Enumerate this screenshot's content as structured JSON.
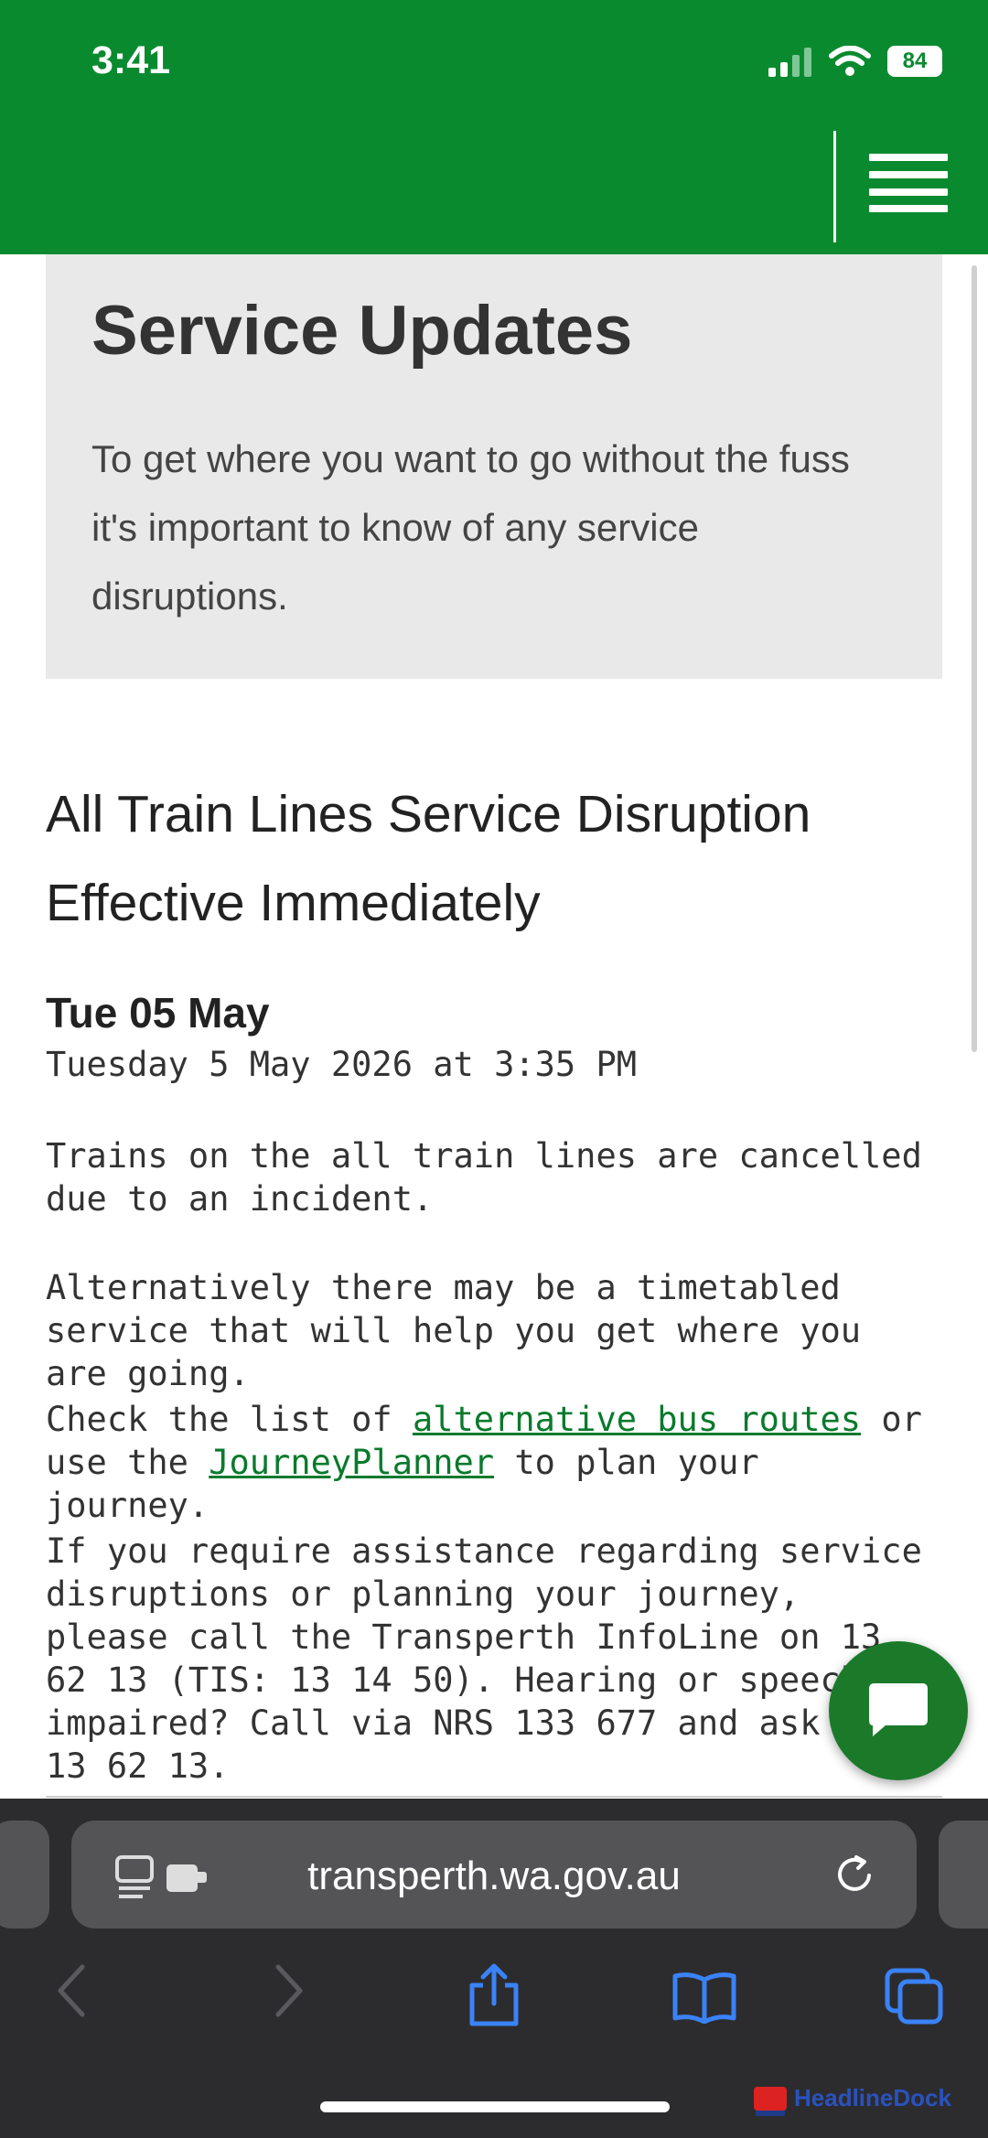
{
  "status_bar": {
    "time": "3:41",
    "battery": "84"
  },
  "hero": {
    "title": "Service Updates",
    "description": "To get where you want to go without the fuss it's important to know of any service disruptions."
  },
  "notice": {
    "title": "All Train Lines Service Disruption Effective Immediately",
    "date_short": "Tue 05 May",
    "date_full": "Tuesday 5 May 2026 at 3:35 PM",
    "para1": "Trains on the all train lines are cancelled due to an incident.",
    "para2": "Alternatively there may be a timetabled service that will help you get where you are going.",
    "para3_pre": "Check the list of ",
    "para3_link1": "alternative bus routes",
    "para3_mid": " or use the ",
    "para3_link2": "JourneyPlanner",
    "para3_post": " to plan your journey.",
    "para4": "If you require assistance regarding service disruptions or planning your journey, please call the Transperth InfoLine on 13 62 13 (TIS: 13 14 50). Hearing or speech impaired? Call via NRS 133 677 and ask for 13 62 13."
  },
  "browser": {
    "url": "transperth.wa.gov.au"
  },
  "watermark": {
    "text": "HeadlineDock"
  },
  "colors": {
    "brand_green": "#0a8a2f",
    "link_green": "#0a7a2c",
    "fab_green": "#1a7a2a",
    "ios_blue": "#3a82f7"
  }
}
